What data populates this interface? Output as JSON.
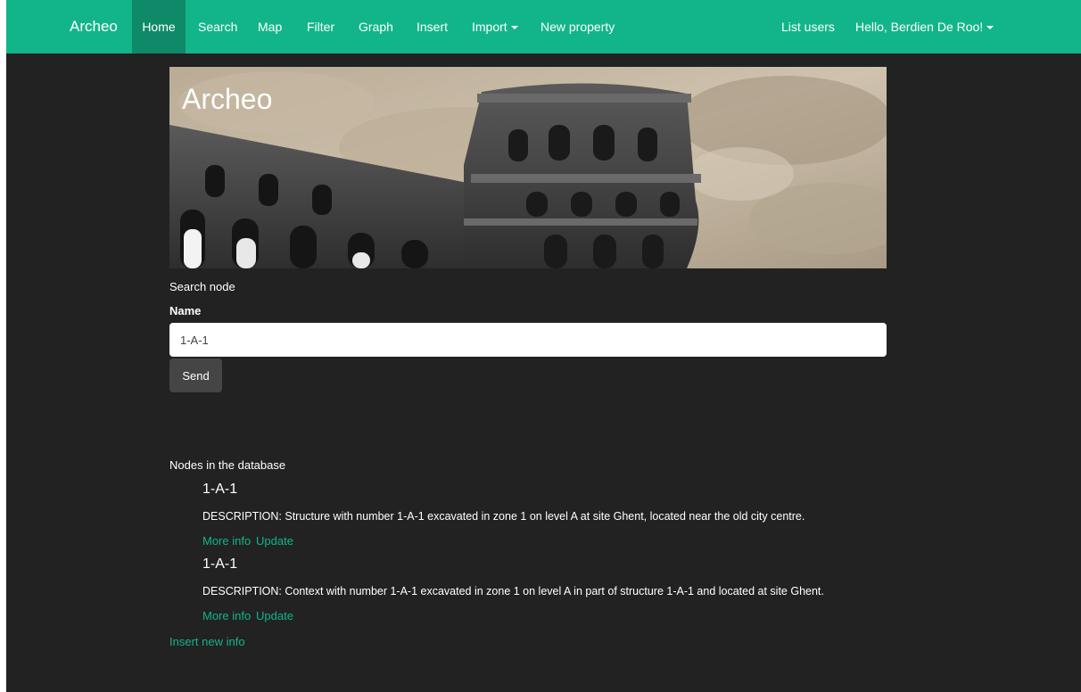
{
  "navbar": {
    "brand": "Archeo",
    "items": [
      {
        "label": "Home"
      },
      {
        "label": "Search"
      },
      {
        "label": "Map"
      },
      {
        "label": "Filter"
      },
      {
        "label": "Graph"
      },
      {
        "label": "Insert"
      },
      {
        "label": "Import"
      },
      {
        "label": "New property"
      }
    ],
    "right": {
      "list_users": "List users",
      "user_greeting": "Hello, Berdien De Roo!"
    },
    "color": "#12b589"
  },
  "hero": {
    "title": "Archeo"
  },
  "search": {
    "section_label": "Search node",
    "name_label": "Name",
    "name_value": "1-A-1",
    "send_label": "Send"
  },
  "nodes": {
    "heading": "Nodes in the database",
    "items": [
      {
        "title": "1-A-1",
        "description": "DESCRIPTION: Structure with number 1-A-1 excavated in zone 1 on level A at site Ghent, located near the old city centre.",
        "more_info": "More info",
        "update": "Update"
      },
      {
        "title": "1-A-1",
        "description": "DESCRIPTION: Context with number 1-A-1 excavated in zone 1 on level A in part of structure 1-A-1 and located at site Ghent.",
        "more_info": "More info",
        "update": "Update"
      }
    ],
    "insert_link": "Insert new info"
  }
}
